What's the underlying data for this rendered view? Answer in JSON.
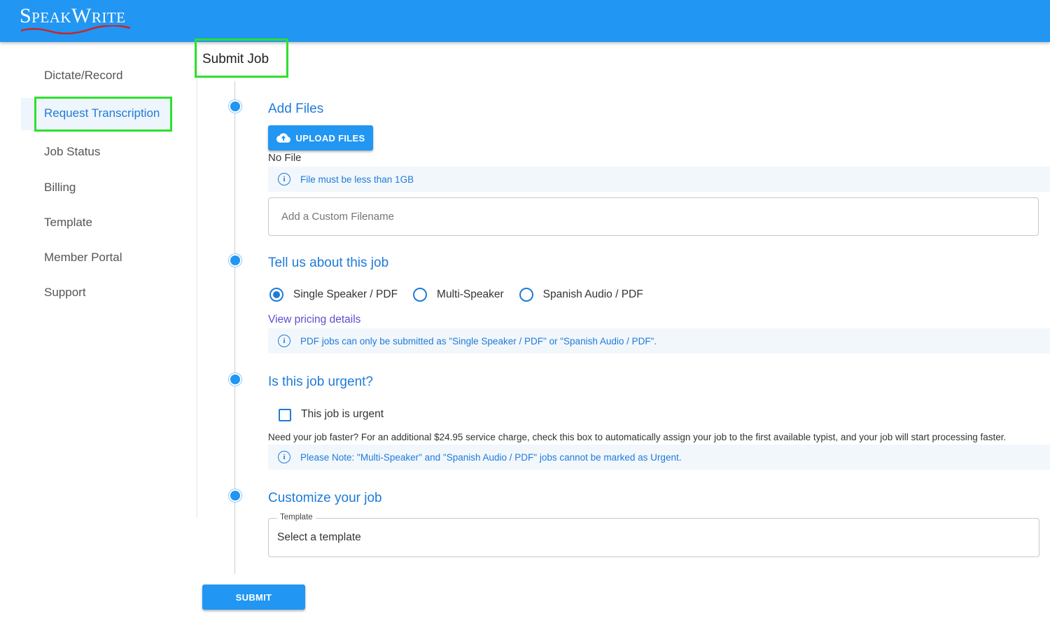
{
  "brand": {
    "logo_text": "SpeakWrite"
  },
  "sidebar": {
    "items": [
      {
        "label": "Dictate/Record"
      },
      {
        "label": "Request Transcription"
      },
      {
        "label": "Job Status"
      },
      {
        "label": "Billing"
      },
      {
        "label": "Template"
      },
      {
        "label": "Member Portal"
      },
      {
        "label": "Support"
      }
    ],
    "active_index": 1
  },
  "page": {
    "title": "Submit Job"
  },
  "add_files": {
    "title": "Add Files",
    "upload_label": "UPLOAD FILES",
    "upload_icon": "cloud-upload-icon",
    "status": "No File",
    "info": "File must be less than 1GB",
    "filename_placeholder": "Add a Custom Filename"
  },
  "job_type": {
    "title": "Tell us about this job",
    "options": [
      "Single Speaker / PDF",
      "Multi-Speaker",
      "Spanish Audio / PDF"
    ],
    "selected": "Single Speaker / PDF",
    "pricing_link": "View pricing details",
    "info": "PDF jobs can only be submitted as \"Single Speaker / PDF\" or \"Spanish Audio / PDF\"."
  },
  "urgent": {
    "title": "Is this job urgent?",
    "checkbox_label": "This job is urgent",
    "checked": false,
    "description": "Need your job faster? For an additional $24.95 service charge, check this box to automatically assign your job to the first available typist, and your job will start processing faster.",
    "info": "Please Note: \"Multi-Speaker\" and \"Spanish Audio / PDF\" jobs cannot be marked as Urgent."
  },
  "customize": {
    "title": "Customize your job",
    "template_legend": "Template",
    "template_value": "Select a template"
  },
  "submit_label": "SUBMIT",
  "colors": {
    "header": "#2196f3",
    "accent": "#1f7bd8",
    "link": "#5a4fcf",
    "highlight": "#2ee02e"
  }
}
